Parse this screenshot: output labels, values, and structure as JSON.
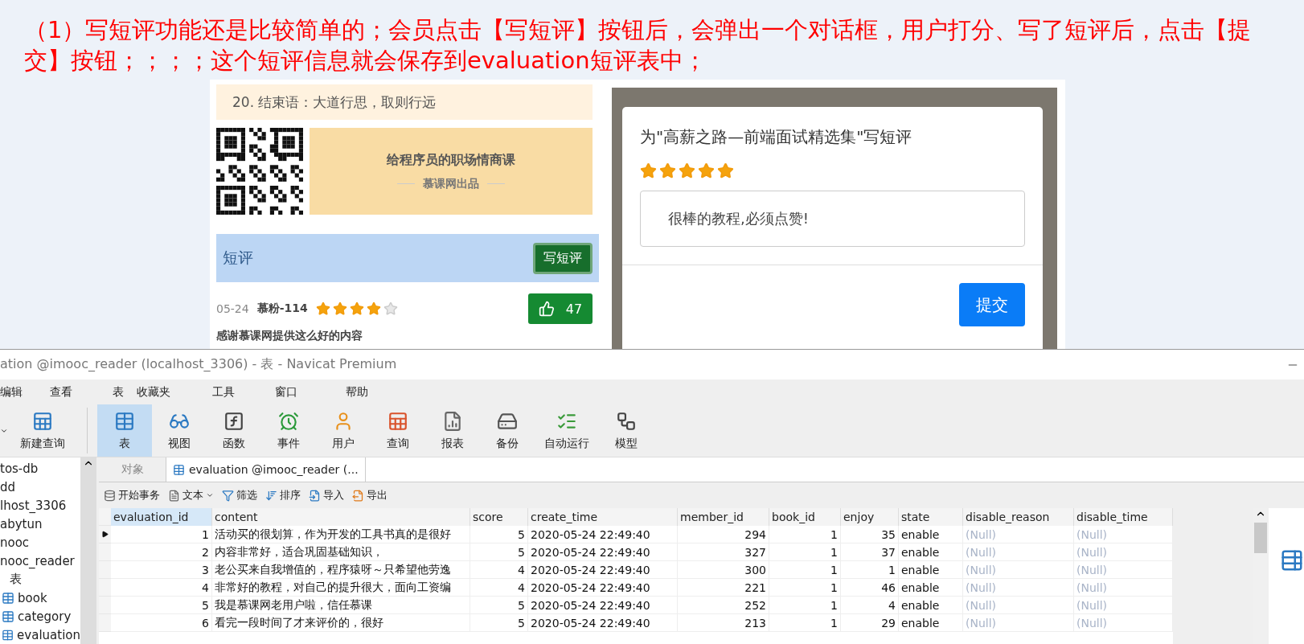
{
  "instruction": {
    "text": "（1）写短评功能还是比较简单的；会员点击【写短评】按钮后，会弹出一个对话框，用户打分、写了短评后，点击【提交】按钮；；；；这个短评信息就会保存到evaluation短评表中；"
  },
  "web_page": {
    "chapter": "20. 结束语：大道行思，取则行远",
    "promo": {
      "title": "给程序员的职场情商课",
      "subtitle": "慕课网出品"
    },
    "section": {
      "title": "短评",
      "button": "写短评"
    },
    "review": {
      "date": "05-24",
      "user": "慕粉-114",
      "stars": 4,
      "likes": "47",
      "text": "感谢慕课网提供这么好的内容"
    },
    "dialog": {
      "title": "为\"高薪之路—前端面试精选集\"写短评",
      "stars": 5,
      "value": "很棒的教程,必须点赞!",
      "button": "提交"
    }
  },
  "navicat": {
    "title": "ation @imooc_reader (localhost_3306) - 表 - Navicat Premium",
    "menu": [
      "编辑",
      "查看",
      "表",
      "收藏夹",
      "工具",
      "窗口",
      "帮助"
    ],
    "new_query": "新建查询",
    "toolbar": [
      {
        "label": "表",
        "selected": true
      },
      {
        "label": "视图",
        "selected": false
      },
      {
        "label": "函数",
        "selected": false
      },
      {
        "label": "事件",
        "selected": false
      },
      {
        "label": "用户",
        "selected": false
      },
      {
        "label": "查询",
        "selected": false
      },
      {
        "label": "报表",
        "selected": false
      },
      {
        "label": "备份",
        "selected": false
      },
      {
        "label": "自动运行",
        "selected": false
      },
      {
        "label": "模型",
        "selected": false
      }
    ],
    "sidebar": [
      {
        "label": "tos-db",
        "kind": "entry"
      },
      {
        "label": "dd",
        "kind": "entry"
      },
      {
        "label": "lhost_3306",
        "kind": "entry"
      },
      {
        "label": "abytun",
        "kind": "entry"
      },
      {
        "label": "nooc",
        "kind": "entry"
      },
      {
        "label": "nooc_reader",
        "kind": "entry"
      },
      {
        "label": "表",
        "kind": "folder"
      },
      {
        "label": "book",
        "kind": "table"
      },
      {
        "label": "category",
        "kind": "table"
      },
      {
        "label": "evaluation",
        "kind": "table"
      }
    ],
    "tabs": [
      {
        "label": "对象",
        "selected": false
      },
      {
        "label": "evaluation @imooc_reader (...",
        "selected": true
      }
    ],
    "actions": [
      {
        "label": "开始事务",
        "dropdown": false
      },
      {
        "label": "文本",
        "dropdown": true
      },
      {
        "label": "筛选",
        "dropdown": false
      },
      {
        "label": "排序",
        "dropdown": false
      },
      {
        "label": "导入",
        "dropdown": false
      },
      {
        "label": "导出",
        "dropdown": false
      }
    ],
    "table": {
      "columns": [
        {
          "name": "evaluation_id",
          "selected": true
        },
        {
          "name": "content",
          "selected": false
        },
        {
          "name": "score",
          "selected": false
        },
        {
          "name": "create_time",
          "selected": false
        },
        {
          "name": "member_id",
          "selected": false
        },
        {
          "name": "book_id",
          "selected": false
        },
        {
          "name": "enjoy",
          "selected": false
        },
        {
          "name": "state",
          "selected": false
        },
        {
          "name": "disable_reason",
          "selected": false
        },
        {
          "name": "disable_time",
          "selected": false
        }
      ],
      "rows": [
        {
          "selected": true,
          "cells": [
            "1",
            "活动买的很划算，作为开发的工具书真的是很好",
            "5",
            "2020-05-24 22:49:40",
            "294",
            "1",
            "35",
            "enable",
            "(Null)",
            "(Null)"
          ]
        },
        {
          "selected": false,
          "cells": [
            "2",
            "内容非常好，适合巩固基础知识，",
            "5",
            "2020-05-24 22:49:40",
            "327",
            "1",
            "37",
            "enable",
            "(Null)",
            "(Null)"
          ]
        },
        {
          "selected": false,
          "cells": [
            "3",
            "老公买来自我增值的，程序猿呀～只希望他劳逸",
            "4",
            "2020-05-24 22:49:40",
            "300",
            "1",
            "1",
            "enable",
            "(Null)",
            "(Null)"
          ]
        },
        {
          "selected": false,
          "cells": [
            "4",
            "非常好的教程，对自己的提升很大，面向工资编",
            "4",
            "2020-05-24 22:49:40",
            "221",
            "1",
            "46",
            "enable",
            "(Null)",
            "(Null)"
          ]
        },
        {
          "selected": false,
          "cells": [
            "5",
            "我是慕课网老用户啦，信任慕课",
            "5",
            "2020-05-24 22:49:40",
            "252",
            "1",
            "4",
            "enable",
            "(Null)",
            "(Null)"
          ]
        },
        {
          "selected": false,
          "cells": [
            "6",
            "看完一段时间了才来评价的，很好",
            "5",
            "2020-05-24 22:49:40",
            "213",
            "1",
            "29",
            "enable",
            "(Null)",
            "(Null)"
          ]
        }
      ]
    }
  }
}
